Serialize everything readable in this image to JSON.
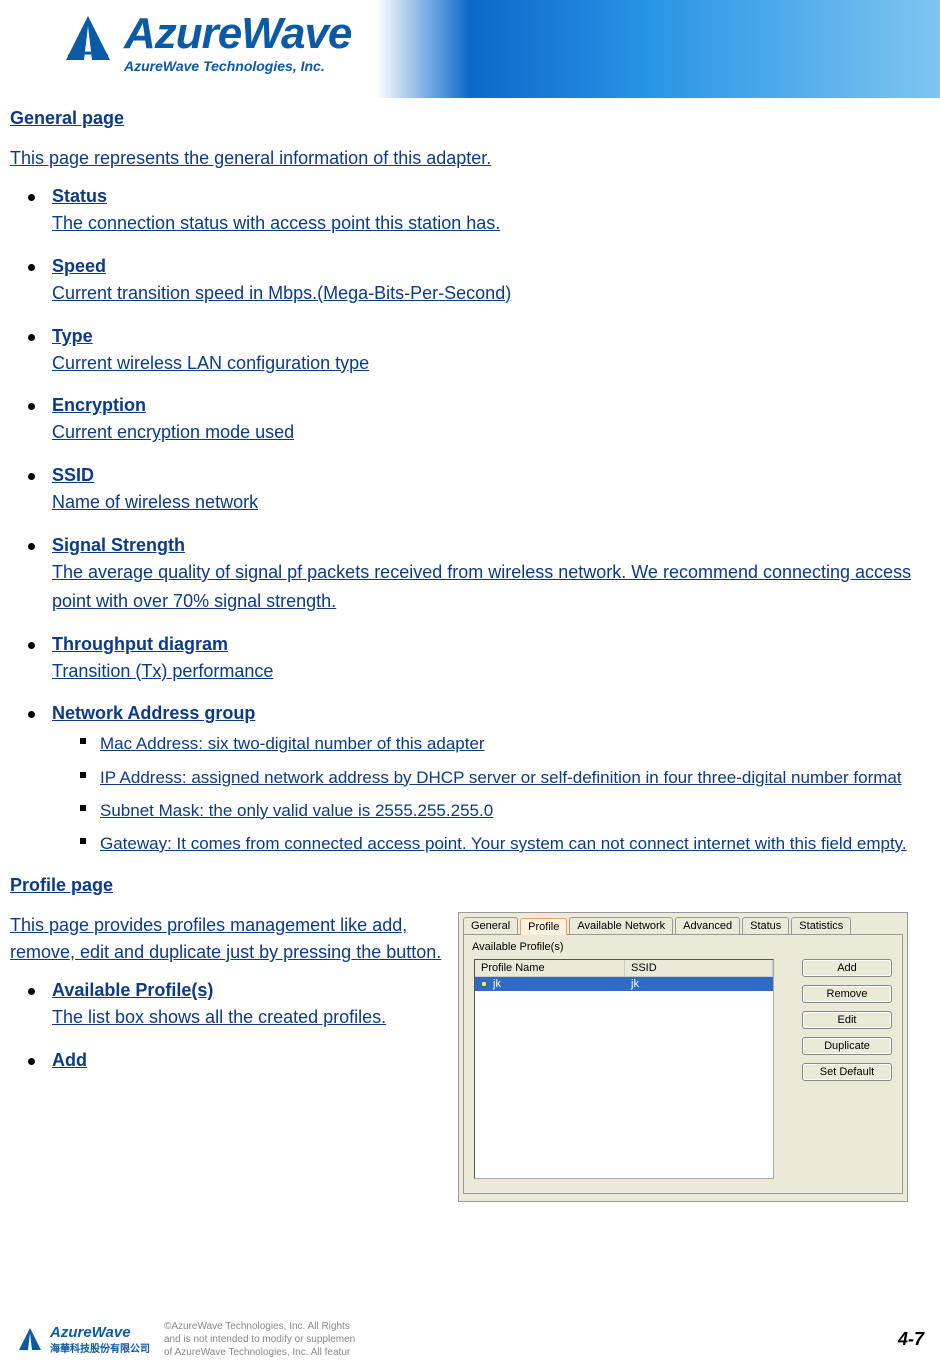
{
  "brand": {
    "name": "AzureWave",
    "tagline": "AzureWave  Technologies,  Inc."
  },
  "general": {
    "heading": "General page",
    "intro": "This page represents the general information of this adapter.",
    "items": [
      {
        "title": "Status",
        "desc": "The connection status with access point this station has."
      },
      {
        "title": "Speed",
        "desc": "Current transition speed in Mbps.(Mega-Bits-Per-Second)"
      },
      {
        "title": "Type",
        "desc": "Current wireless LAN configuration type"
      },
      {
        "title": "Encryption",
        "desc": "Current encryption mode used"
      },
      {
        "title": "SSID",
        "desc": "Name of wireless network"
      },
      {
        "title": "Signal Strength",
        "desc": "The average quality of signal pf packets received from wireless network. We recommend connecting access point with over 70% signal strength."
      },
      {
        "title": "Throughput diagram",
        "desc": "Transition (Tx) performance"
      },
      {
        "title": "Network Address group",
        "desc": "",
        "sub": [
          "Mac Address: six two-digital number of this adapter",
          "IP Address: assigned network address by DHCP server or self-definition in four three-digital number format",
          "Subnet Mask: the only valid value is 2555.255.255.0",
          "Gateway: It comes from connected access point. Your system can not connect internet with this field empty."
        ]
      }
    ]
  },
  "profile": {
    "heading": "Profile page",
    "intro": "This page provides profiles management like add, remove, edit and duplicate just by pressing the button.",
    "items": [
      {
        "title": "Available Profile(s)",
        "desc": "The list box shows all the created profiles."
      },
      {
        "title": "Add",
        "desc": ""
      }
    ]
  },
  "dialog": {
    "tabs": [
      "General",
      "Profile",
      "Available Network",
      "Advanced",
      "Status",
      "Statistics"
    ],
    "active_tab": 1,
    "avail_label": "Available Profile(s)",
    "col1": "Profile Name",
    "col2": "SSID",
    "row": {
      "name": "jk",
      "ssid": "jk"
    },
    "buttons": [
      "Add",
      "Remove",
      "Edit",
      "Duplicate",
      "Set Default"
    ]
  },
  "footer": {
    "brand": "AzureWave",
    "brand_cn": "海華科技股份有限公司",
    "legal_1": "©AzureWave Technologies, Inc. All Rights",
    "legal_2": "and is not intended to modify or supplemen",
    "legal_3": "of AzureWave Technologies, Inc.  All featur",
    "page": "4-7"
  }
}
